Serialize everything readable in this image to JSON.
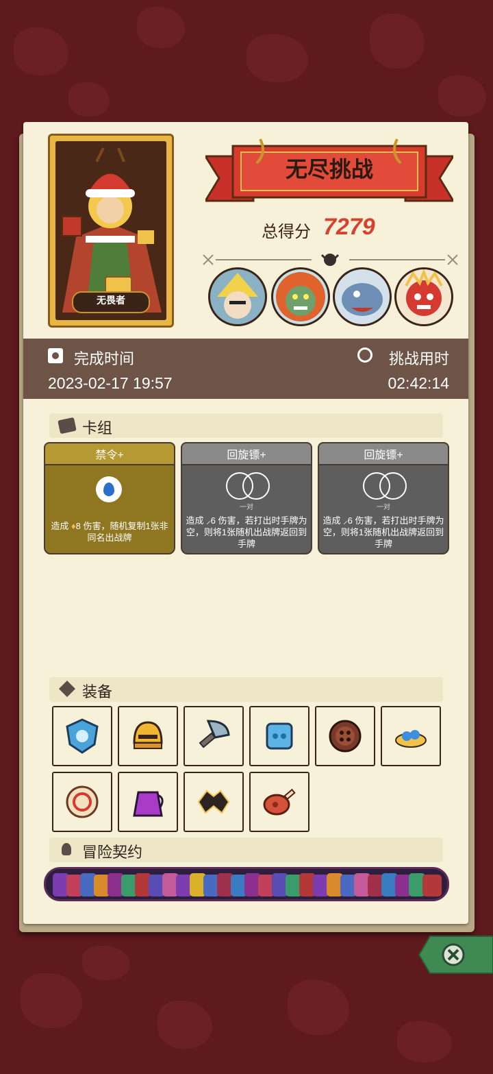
{
  "header": {
    "title": "无尽挑战",
    "score_label": "总得分",
    "score_value": "7279"
  },
  "hero": {
    "name": "无畏者"
  },
  "bosses": [
    {
      "name": "boss-witch"
    },
    {
      "name": "boss-orc"
    },
    {
      "name": "boss-beast"
    },
    {
      "name": "boss-demon"
    }
  ],
  "info": {
    "complete_time_label": "完成时间",
    "complete_time_value": "2023-02-17 19:57",
    "challenge_time_label": "挑战用时",
    "challenge_time_value": "02:42:14"
  },
  "deck": {
    "title": "卡组",
    "cards": [
      {
        "name": "禁令+",
        "desc_prefix": "造成",
        "damage": "8",
        "desc_suffix": "伤害，随机复制1张非同名出战牌",
        "sub": "",
        "color": "#8f7620"
      },
      {
        "name": "回旋镖+",
        "desc_prefix": "造成",
        "damage": "6",
        "desc_suffix": "伤害，若打出时手牌为空，则将1张随机出战牌返回到手牌",
        "sub": "一对",
        "color": "#5e5e5e"
      },
      {
        "name": "回旋镖+",
        "desc_prefix": "造成",
        "damage": "6",
        "desc_suffix": "伤害，若打出时手牌为空，则将1张随机出战牌返回到手牌",
        "sub": "一对",
        "color": "#5e5e5e"
      }
    ]
  },
  "equipment": {
    "title": "装备",
    "items": [
      {
        "name": "shield-icon",
        "bg": "#e09a32"
      },
      {
        "name": "helmet-icon",
        "bg": "#2e4f80"
      },
      {
        "name": "cleaver-icon",
        "bg": "#2e4f80"
      },
      {
        "name": "dice-icon",
        "bg": "#e09a32"
      },
      {
        "name": "button-icon",
        "bg": "#8a35a6"
      },
      {
        "name": "gems-icon",
        "bg": "#e09a32"
      },
      {
        "name": "ring-icon",
        "bg": "#e09a32"
      },
      {
        "name": "potion-jug-icon",
        "bg": "#2e4f80"
      },
      {
        "name": "bat-wing-icon",
        "bg": "#e09a32"
      },
      {
        "name": "meat-icon",
        "bg": "#e09a32"
      }
    ]
  },
  "contract": {
    "title": "冒险契约"
  }
}
